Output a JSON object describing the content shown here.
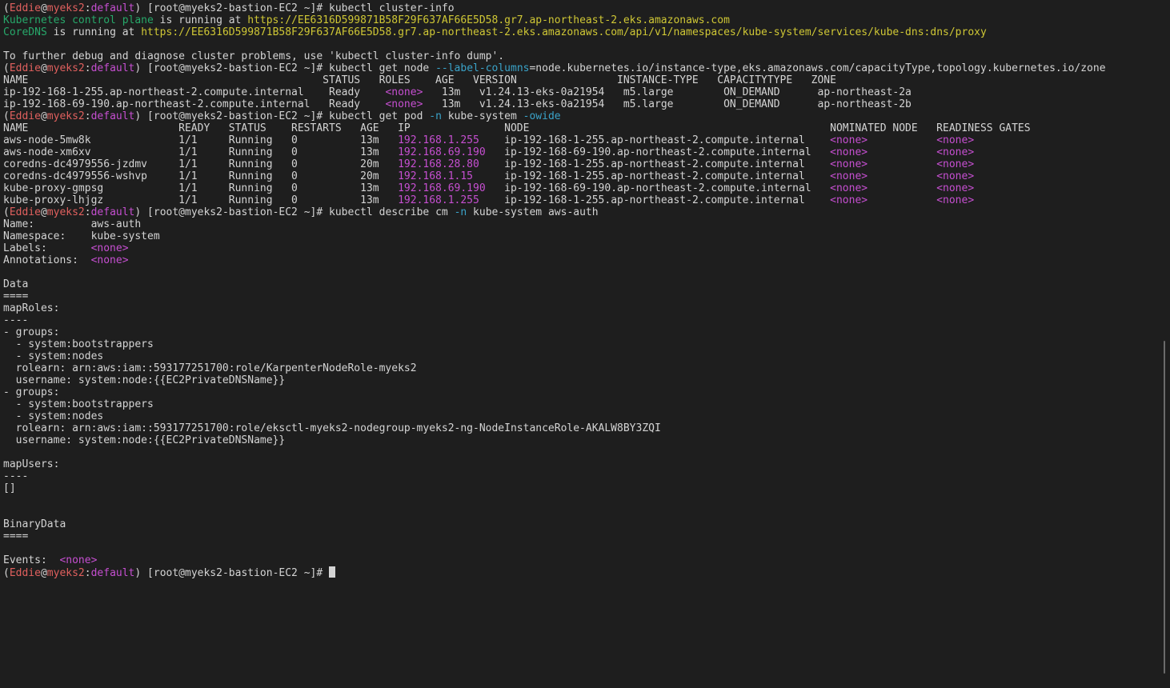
{
  "colors": {
    "background": "#1e1e1e",
    "foreground": "#d4d4d4",
    "prompt_user": "#e0605e",
    "magenta": "#c64fd1",
    "cyan": "#3aa3c9",
    "green": "#27a86a",
    "yellow": "#cfc735"
  },
  "terminal": {
    "lines": [
      [
        {
          "t": "("
        },
        {
          "t": "Eddie",
          "c": "red"
        },
        {
          "t": "@"
        },
        {
          "t": "myeks2",
          "c": "red"
        },
        {
          "t": ":"
        },
        {
          "t": "default",
          "c": "magenta"
        },
        {
          "t": ") [root@myeks2-bastion-EC2 ~]# kubectl cluster-info"
        }
      ],
      [
        {
          "t": "Kubernetes control plane",
          "c": "green"
        },
        {
          "t": " is running at "
        },
        {
          "t": "https://EE6316D599871B58F29F637AF66E5D58.gr7.ap-northeast-2.eks.amazonaws.com",
          "c": "yellow"
        }
      ],
      [
        {
          "t": "CoreDNS",
          "c": "green"
        },
        {
          "t": " is running at "
        },
        {
          "t": "https://EE6316D599871B58F29F637AF66E5D58.gr7.ap-northeast-2.eks.amazonaws.com/api/v1/namespaces/kube-system/services/kube-dns:dns/proxy",
          "c": "yellow"
        }
      ],
      [],
      [
        {
          "t": "To further debug and diagnose cluster problems, use 'kubectl cluster-info dump'."
        }
      ],
      [
        {
          "t": "("
        },
        {
          "t": "Eddie",
          "c": "red"
        },
        {
          "t": "@"
        },
        {
          "t": "myeks2",
          "c": "red"
        },
        {
          "t": ":"
        },
        {
          "t": "default",
          "c": "magenta"
        },
        {
          "t": ") [root@myeks2-bastion-EC2 ~]# kubectl get node "
        },
        {
          "t": "--label-columns",
          "c": "cyan"
        },
        {
          "t": "=node.kubernetes.io/instance-type,eks.amazonaws.com/capacityType,topology.kubernetes.io/zone"
        }
      ],
      [
        {
          "t": "NAME                                               STATUS   ROLES    AGE   VERSION                INSTANCE-TYPE   CAPACITYTYPE   ZONE"
        }
      ],
      [
        {
          "t": "ip-192-168-1-255.ap-northeast-2.compute.internal    Ready    "
        },
        {
          "t": "<none>",
          "c": "magenta"
        },
        {
          "t": "   13m   v1.24.13-eks-0a21954   m5.large        ON_DEMAND      ap-northeast-2a"
        }
      ],
      [
        {
          "t": "ip-192-168-69-190.ap-northeast-2.compute.internal   Ready    "
        },
        {
          "t": "<none>",
          "c": "magenta"
        },
        {
          "t": "   13m   v1.24.13-eks-0a21954   m5.large        ON_DEMAND      ap-northeast-2b"
        }
      ],
      [
        {
          "t": "("
        },
        {
          "t": "Eddie",
          "c": "red"
        },
        {
          "t": "@"
        },
        {
          "t": "myeks2",
          "c": "red"
        },
        {
          "t": ":"
        },
        {
          "t": "default",
          "c": "magenta"
        },
        {
          "t": ") [root@myeks2-bastion-EC2 ~]# kubectl get pod "
        },
        {
          "t": "-n",
          "c": "cyan"
        },
        {
          "t": " kube-system "
        },
        {
          "t": "-owide",
          "c": "cyan"
        }
      ],
      [
        {
          "t": "NAME                        READY   STATUS    RESTARTS   AGE   IP               NODE                                                NOMINATED NODE   READINESS GATES"
        }
      ],
      [
        {
          "t": "aws-node-5mw8k              1/1     Running   0          13m   "
        },
        {
          "t": "192.168.1.255",
          "c": "magenta"
        },
        {
          "t": "    ip-192-168-1-255.ap-northeast-2.compute.internal    "
        },
        {
          "t": "<none>",
          "c": "magenta"
        },
        {
          "t": "           "
        },
        {
          "t": "<none>",
          "c": "magenta"
        }
      ],
      [
        {
          "t": "aws-node-xm6xv              1/1     Running   0          13m   "
        },
        {
          "t": "192.168.69.190",
          "c": "magenta"
        },
        {
          "t": "   ip-192-168-69-190.ap-northeast-2.compute.internal   "
        },
        {
          "t": "<none>",
          "c": "magenta"
        },
        {
          "t": "           "
        },
        {
          "t": "<none>",
          "c": "magenta"
        }
      ],
      [
        {
          "t": "coredns-dc4979556-jzdmv     1/1     Running   0          20m   "
        },
        {
          "t": "192.168.28.80",
          "c": "magenta"
        },
        {
          "t": "    ip-192-168-1-255.ap-northeast-2.compute.internal    "
        },
        {
          "t": "<none>",
          "c": "magenta"
        },
        {
          "t": "           "
        },
        {
          "t": "<none>",
          "c": "magenta"
        }
      ],
      [
        {
          "t": "coredns-dc4979556-wshvp     1/1     Running   0          20m   "
        },
        {
          "t": "192.168.1.15",
          "c": "magenta"
        },
        {
          "t": "     ip-192-168-1-255.ap-northeast-2.compute.internal    "
        },
        {
          "t": "<none>",
          "c": "magenta"
        },
        {
          "t": "           "
        },
        {
          "t": "<none>",
          "c": "magenta"
        }
      ],
      [
        {
          "t": "kube-proxy-gmpsg            1/1     Running   0          13m   "
        },
        {
          "t": "192.168.69.190",
          "c": "magenta"
        },
        {
          "t": "   ip-192-168-69-190.ap-northeast-2.compute.internal   "
        },
        {
          "t": "<none>",
          "c": "magenta"
        },
        {
          "t": "           "
        },
        {
          "t": "<none>",
          "c": "magenta"
        }
      ],
      [
        {
          "t": "kube-proxy-lhjgz            1/1     Running   0          13m   "
        },
        {
          "t": "192.168.1.255",
          "c": "magenta"
        },
        {
          "t": "    ip-192-168-1-255.ap-northeast-2.compute.internal    "
        },
        {
          "t": "<none>",
          "c": "magenta"
        },
        {
          "t": "           "
        },
        {
          "t": "<none>",
          "c": "magenta"
        }
      ],
      [
        {
          "t": "("
        },
        {
          "t": "Eddie",
          "c": "red"
        },
        {
          "t": "@"
        },
        {
          "t": "myeks2",
          "c": "red"
        },
        {
          "t": ":"
        },
        {
          "t": "default",
          "c": "magenta"
        },
        {
          "t": ") [root@myeks2-bastion-EC2 ~]# kubectl describe cm "
        },
        {
          "t": "-n",
          "c": "cyan"
        },
        {
          "t": " kube-system aws-auth"
        }
      ],
      [
        {
          "t": "Name:         aws-auth"
        }
      ],
      [
        {
          "t": "Namespace:    kube-system"
        }
      ],
      [
        {
          "t": "Labels:       "
        },
        {
          "t": "<none>",
          "c": "magenta"
        }
      ],
      [
        {
          "t": "Annotations:  "
        },
        {
          "t": "<none>",
          "c": "magenta"
        }
      ],
      [],
      [
        {
          "t": "Data"
        }
      ],
      [
        {
          "t": "===="
        }
      ],
      [
        {
          "t": "mapRoles:"
        }
      ],
      [
        {
          "t": "----"
        }
      ],
      [
        {
          "t": "- groups:"
        }
      ],
      [
        {
          "t": "  - system:bootstrappers"
        }
      ],
      [
        {
          "t": "  - system:nodes"
        }
      ],
      [
        {
          "t": "  rolearn: arn:aws:iam::593177251700:role/KarpenterNodeRole-myeks2"
        }
      ],
      [
        {
          "t": "  username: system:node:{{EC2PrivateDNSName}}"
        }
      ],
      [
        {
          "t": "- groups:"
        }
      ],
      [
        {
          "t": "  - system:bootstrappers"
        }
      ],
      [
        {
          "t": "  - system:nodes"
        }
      ],
      [
        {
          "t": "  rolearn: arn:aws:iam::593177251700:role/eksctl-myeks2-nodegroup-myeks2-ng-NodeInstanceRole-AKALW8BY3ZQI"
        }
      ],
      [
        {
          "t": "  username: system:node:{{EC2PrivateDNSName}}"
        }
      ],
      [],
      [
        {
          "t": "mapUsers:"
        }
      ],
      [
        {
          "t": "----"
        }
      ],
      [
        {
          "t": "[]"
        }
      ],
      [],
      [],
      [
        {
          "t": "BinaryData"
        }
      ],
      [
        {
          "t": "===="
        }
      ],
      [],
      [
        {
          "t": "Events:  "
        },
        {
          "t": "<none>",
          "c": "magenta"
        }
      ],
      [
        {
          "t": "("
        },
        {
          "t": "Eddie",
          "c": "red"
        },
        {
          "t": "@"
        },
        {
          "t": "myeks2",
          "c": "red"
        },
        {
          "t": ":"
        },
        {
          "t": "default",
          "c": "magenta"
        },
        {
          "t": ") [root@myeks2-bastion-EC2 ~]# "
        }
      ]
    ]
  }
}
